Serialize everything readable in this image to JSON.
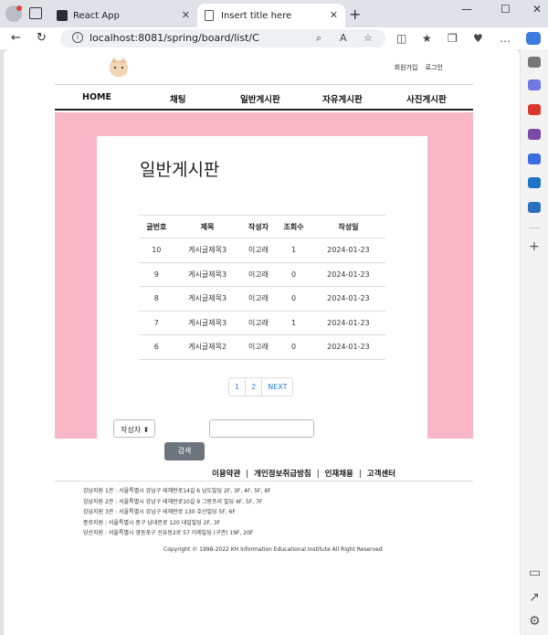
{
  "browser": {
    "tabs": [
      {
        "title": "React App"
      },
      {
        "title": "Insert title here"
      }
    ],
    "url": "localhost:8081/spring/board/list/C",
    "new_tab_symbol": "+",
    "close_symbol": "✕",
    "window_controls": {
      "minimize": "—",
      "maximize": "☐",
      "close": "✕"
    }
  },
  "site": {
    "auth_links": [
      "회원가입",
      "로그인"
    ],
    "nav": [
      "HOME",
      "채팅",
      "일반게시판",
      "자유게시판",
      "사진게시판"
    ]
  },
  "board": {
    "title": "일반게시판",
    "columns": [
      "글번호",
      "제목",
      "작성자",
      "조회수",
      "작성일"
    ],
    "rows": [
      [
        "10",
        "게시글제목3",
        "이고래",
        "1",
        "2024-01-23"
      ],
      [
        "9",
        "게시글제목3",
        "이고래",
        "0",
        "2024-01-23"
      ],
      [
        "8",
        "게시글제목3",
        "이고래",
        "0",
        "2024-01-23"
      ],
      [
        "7",
        "게시글제목3",
        "이고래",
        "1",
        "2024-01-23"
      ],
      [
        "6",
        "게시글제목2",
        "이고래",
        "0",
        "2024-01-23"
      ]
    ],
    "pagination": [
      "1",
      "2",
      "NEXT"
    ]
  },
  "search": {
    "select_value": "작성자",
    "input_value": "",
    "button_label": "검색"
  },
  "footer": {
    "links": [
      "이용약관",
      "개인정보취급방침",
      "인재채용",
      "고객센터"
    ],
    "separator": "|",
    "branches": [
      "강남지원 1관 : 서울특별시 강남구 테헤란로14길 6 남도빌딩 2F, 3F, 4F, 5F, 6F",
      "강남지원 2관 : 서울특별시 강남구 테헤란로10길 9 그랑프리 빌딩 4F, 5F, 7F",
      "강남지원 3관 : 서울특별시 강남구 테헤란로 130 호산빌딩 5F, 6F",
      "종로지원 : 서울특별시 중구 남대문로 120 대일빌딩 2F, 3F",
      "당산지원 : 서울특별시 영등포구 선유동2로 57 이레빌딩 (구관) 19F, 20F"
    ],
    "copyright": "Copyright © 1998-2022 KH Information Educational Institute All Right Reserved"
  }
}
